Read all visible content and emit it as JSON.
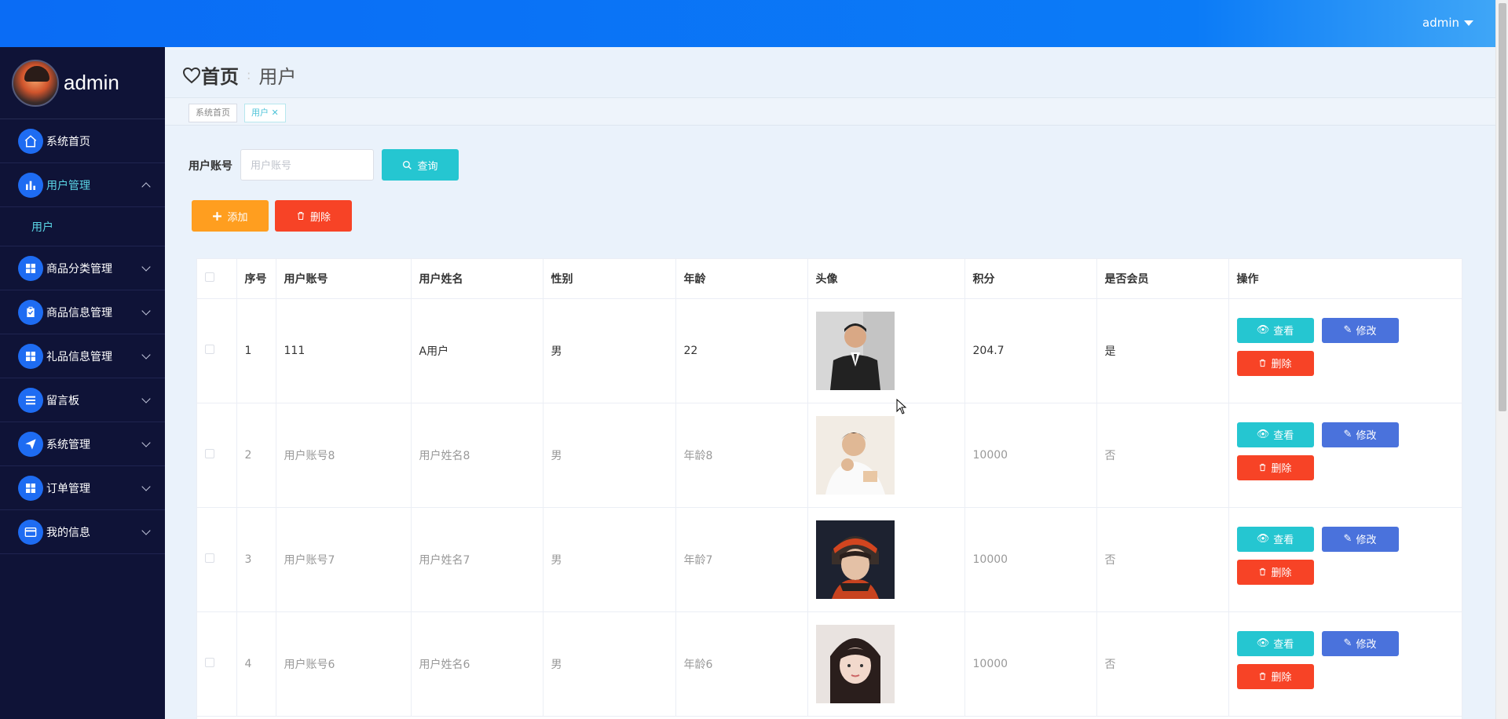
{
  "header": {
    "user": "admin"
  },
  "sidebar": {
    "profile_name": "admin",
    "items": [
      {
        "label": "系统首页",
        "icon": "home-icon"
      },
      {
        "label": "用户管理",
        "icon": "bar-chart-icon",
        "expanded": true,
        "children": [
          {
            "label": "用户"
          }
        ]
      },
      {
        "label": "商品分类管理",
        "icon": "grid-icon"
      },
      {
        "label": "商品信息管理",
        "icon": "clipboard-icon"
      },
      {
        "label": "礼品信息管理",
        "icon": "grid-icon"
      },
      {
        "label": "留言板",
        "icon": "list-icon"
      },
      {
        "label": "系统管理",
        "icon": "send-icon"
      },
      {
        "label": "订单管理",
        "icon": "grid-icon"
      },
      {
        "label": "我的信息",
        "icon": "card-icon"
      }
    ]
  },
  "breadcrumb": {
    "home": "首页",
    "current": "用户"
  },
  "tabs": [
    {
      "label": "系统首页"
    },
    {
      "label": "用户"
    }
  ],
  "search": {
    "label": "用户账号",
    "placeholder": "用户账号",
    "button": "查询"
  },
  "actions": {
    "add": "添加",
    "delete": "删除"
  },
  "table": {
    "columns": [
      "序号",
      "用户账号",
      "用户姓名",
      "性别",
      "年龄",
      "头像",
      "积分",
      "是否会员",
      "操作"
    ],
    "rows": [
      {
        "no": "1",
        "account": "111",
        "name": "A用户",
        "gender": "男",
        "age": "22",
        "points": "204.7",
        "member": "是"
      },
      {
        "no": "2",
        "account": "用户账号8",
        "name": "用户姓名8",
        "gender": "男",
        "age": "年龄8",
        "points": "10000",
        "member": "否"
      },
      {
        "no": "3",
        "account": "用户账号7",
        "name": "用户姓名7",
        "gender": "男",
        "age": "年龄7",
        "points": "10000",
        "member": "否"
      },
      {
        "no": "4",
        "account": "用户账号6",
        "name": "用户姓名6",
        "gender": "男",
        "age": "年龄6",
        "points": "10000",
        "member": "否"
      }
    ],
    "op_labels": {
      "view": "查看",
      "edit": "修改",
      "delete": "删除"
    }
  },
  "colors": {
    "topbar": "#0a6cf5",
    "sidebar": "#0f1337",
    "accent": "#25c6d1",
    "edit": "#4a72dc",
    "danger": "#f74326",
    "warning": "#ff9e1f"
  }
}
